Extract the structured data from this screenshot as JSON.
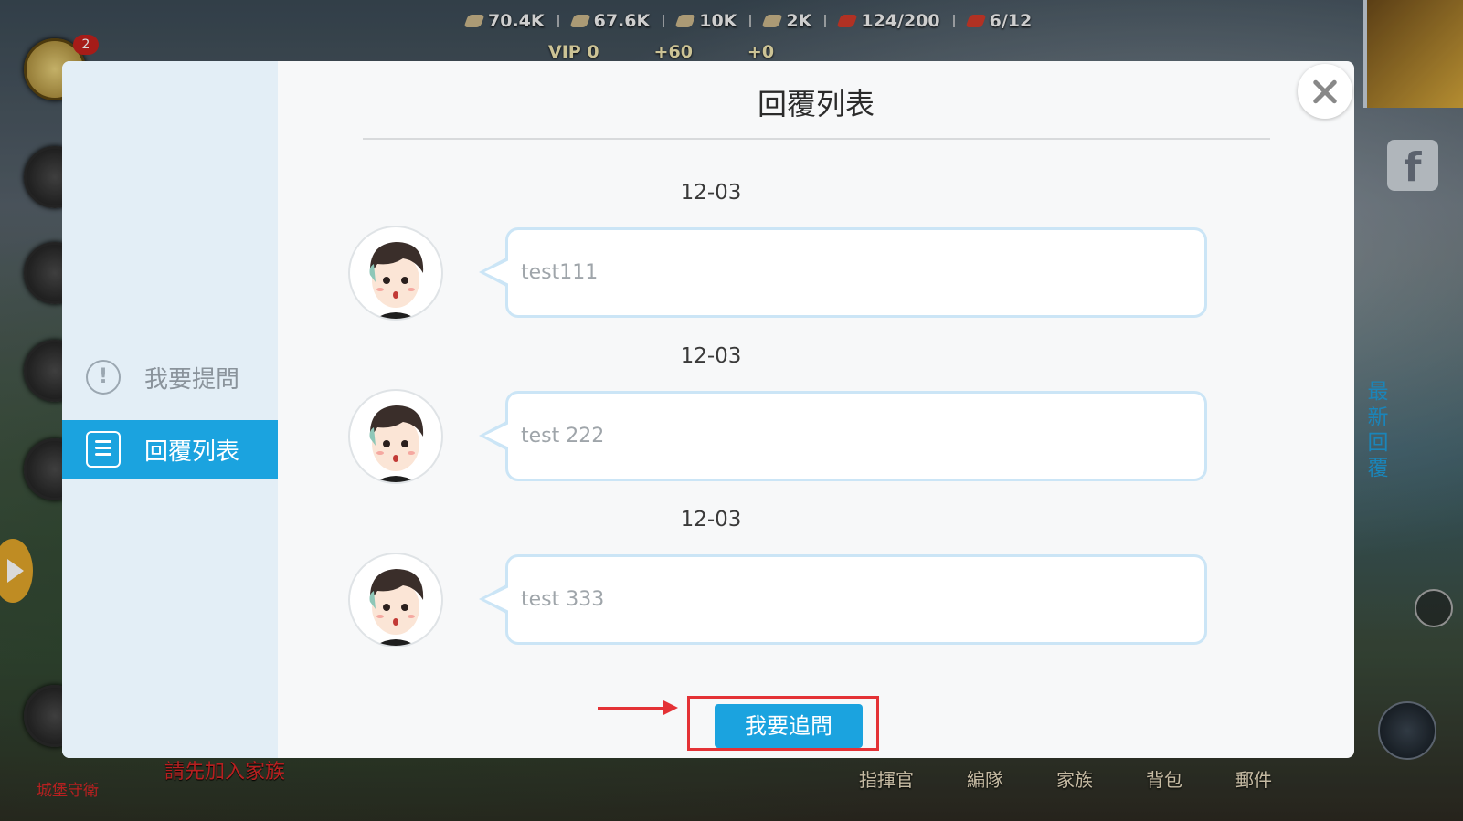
{
  "hud": {
    "resources": [
      "70.4K",
      "67.6K",
      "10K",
      "2K",
      "124/200",
      "6/12"
    ],
    "vip_label": "VIP 0",
    "gold_plus": "60",
    "gem_plus": "0",
    "badge_count": "2",
    "join_family_text": "請先加入家族",
    "castle_guard_text": "城堡守衛",
    "latest_reply_label": "最新回覆",
    "bottom_nav": [
      "指揮官",
      "編隊",
      "家族",
      "背包",
      "郵件"
    ]
  },
  "modal": {
    "title": "回覆列表",
    "sidebar": {
      "items": [
        {
          "label": "我要提問",
          "icon": "exclamation-icon"
        },
        {
          "label": "回覆列表",
          "icon": "list-icon",
          "active": true
        }
      ]
    },
    "replies": [
      {
        "date": "12-03",
        "text": "test111"
      },
      {
        "date": "12-03",
        "text": "test 222"
      },
      {
        "date": "12-03",
        "text": "test 333"
      }
    ],
    "follow_up_label": "我要追問",
    "colors": {
      "accent": "#1ba3df",
      "highlight_red": "#e43236"
    }
  }
}
